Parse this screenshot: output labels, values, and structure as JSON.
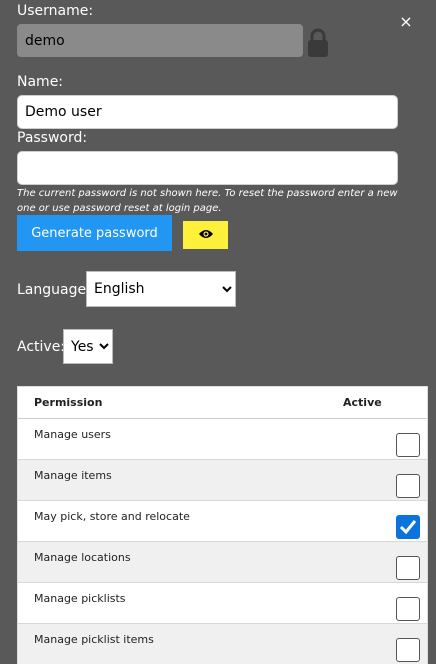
{
  "username": {
    "label": "Username:",
    "value": "demo"
  },
  "close": {
    "glyph": "×"
  },
  "name": {
    "label": "Name:",
    "value": "Demo user"
  },
  "password": {
    "label": "Password:",
    "value": "",
    "hint": "The current password is not shown here. To reset the password enter a new one or use password reset at login page."
  },
  "buttons": {
    "generate_label": "Generate password",
    "show_password_icon": "eye-icon"
  },
  "language": {
    "label": "Language:",
    "selected": "English"
  },
  "active": {
    "label": "Active:",
    "selected": "Yes"
  },
  "permissions": {
    "headers": {
      "permission": "Permission",
      "active": "Active"
    },
    "rows": [
      {
        "name": "Manage users",
        "active": false
      },
      {
        "name": "Manage items",
        "active": false
      },
      {
        "name": "May pick, store and relocate",
        "active": true
      },
      {
        "name": "Manage locations",
        "active": false
      },
      {
        "name": "Manage picklists",
        "active": false
      },
      {
        "name": "Manage picklist items",
        "active": false
      }
    ]
  },
  "colors": {
    "background": "#595959",
    "primary_button": "#2196f3",
    "eye_button": "#fff03b",
    "checkbox_checked": "#0a74dc"
  }
}
